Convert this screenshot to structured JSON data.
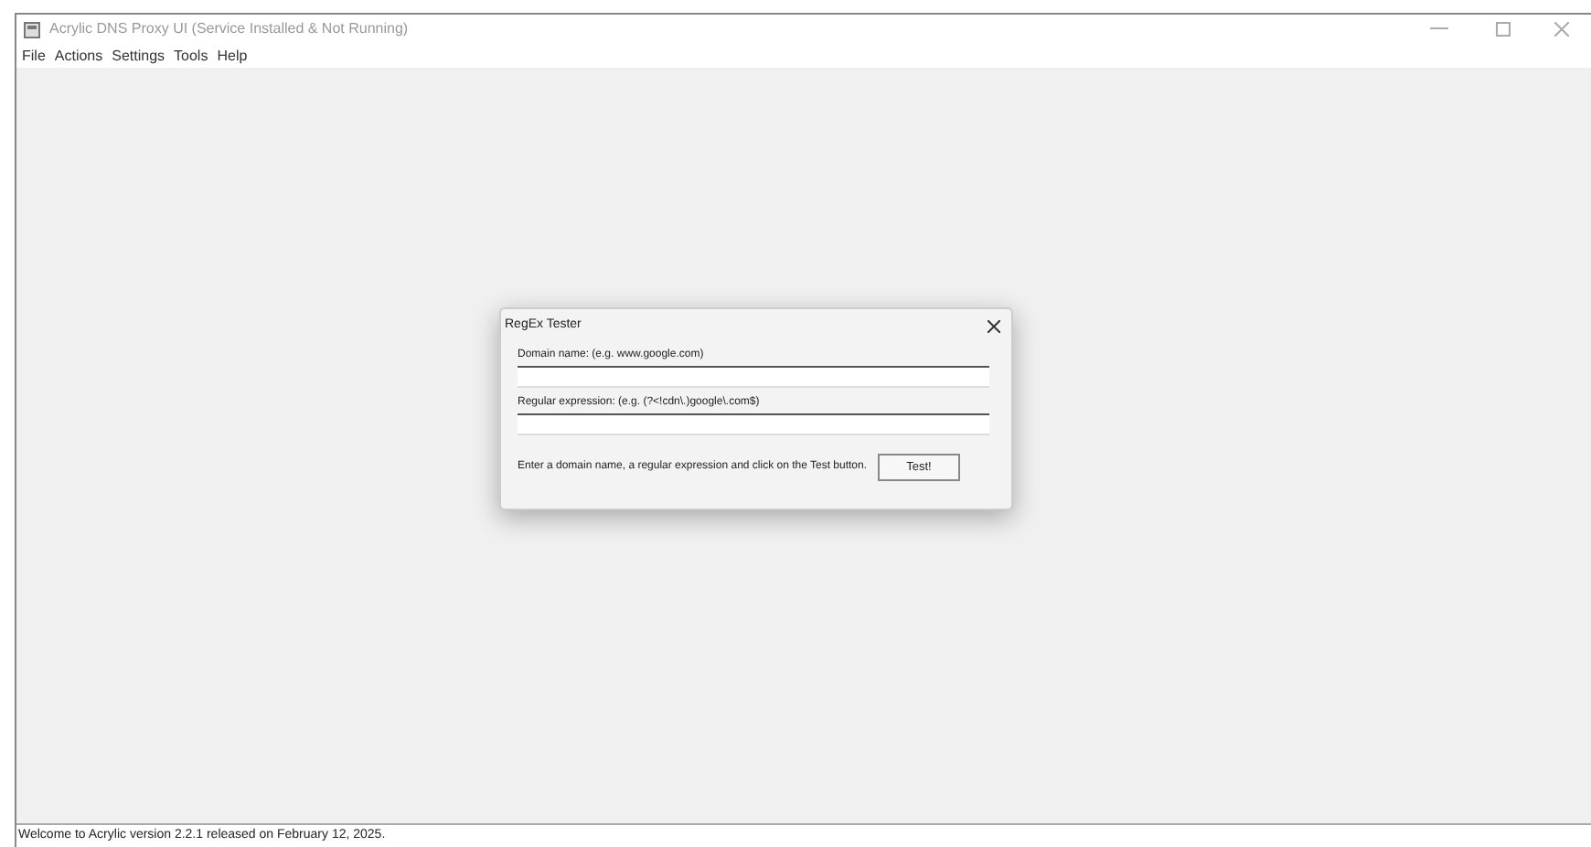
{
  "window": {
    "title": "Acrylic DNS Proxy UI (Service Installed & Not Running)"
  },
  "menu": [
    "File",
    "Actions",
    "Settings",
    "Tools",
    "Help"
  ],
  "dialog": {
    "title": "RegEx Tester",
    "fields": [
      {
        "label": "Domain name: (e.g. www.google.com)"
      },
      {
        "label": "Regular expression: (e.g. (?<!cdn\\.)google\\.com$)"
      }
    ],
    "hint": "Enter a domain name, a regular expression and click on the Test button.",
    "button": "Test!"
  },
  "status_bar": "Welcome to Acrylic version 2.2.1 released on February 12, 2025."
}
